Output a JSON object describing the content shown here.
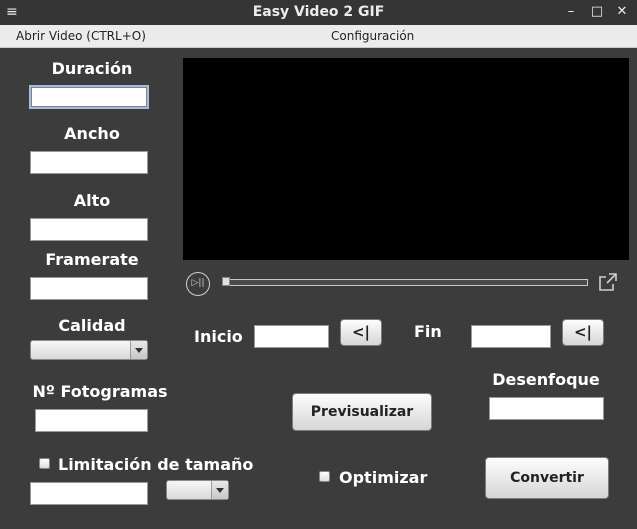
{
  "window": {
    "title": "Easy Video 2 GIF",
    "menu_icon": "≡",
    "minimize": "–",
    "maximize": "□",
    "close": "✕"
  },
  "menubar": {
    "open_video": "Abrir Video (CTRL+O)",
    "settings": "Configuración"
  },
  "left_panel": {
    "duration_label": "Duración",
    "duration_value": "",
    "width_label": "Ancho",
    "width_value": "",
    "height_label": "Alto",
    "height_value": "",
    "framerate_label": "Framerate",
    "framerate_value": "",
    "quality_label": "Calidad",
    "quality_selected": "",
    "frames_label": "Nº Fotogramas",
    "frames_value": "",
    "size_limit_label": "Limitación de tamaño",
    "size_limit_checked": false,
    "size_limit_value": "",
    "size_unit_selected": ""
  },
  "player": {
    "play_pause_glyph": "▷||",
    "progress": 0,
    "popout_icon": "popout-icon"
  },
  "range": {
    "start_label": "Inicio",
    "start_value": "",
    "set_start_button": "<|",
    "end_label": "Fin",
    "end_value": "",
    "set_end_button": "<|"
  },
  "actions": {
    "blur_label": "Desenfoque",
    "blur_value": "",
    "preview_button": "Previsualizar",
    "optimize_label": "Optimizar",
    "optimize_checked": false,
    "convert_button": "Convertir"
  }
}
